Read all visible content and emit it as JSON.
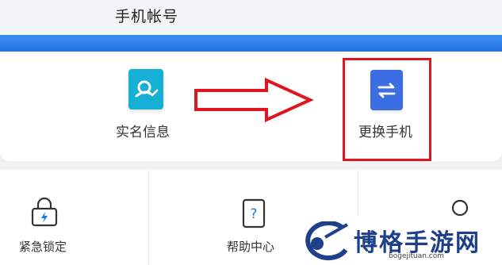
{
  "header": {
    "title": "手机帐号"
  },
  "colors": {
    "accent_blue": "#1f73e6",
    "highlight_red": "#e0141e",
    "teal_tile": "#16b0d6",
    "blue_tile": "#3c6de3"
  },
  "services": [
    {
      "label": "实名信息",
      "icon": "id-verify-icon"
    },
    {
      "label": "更换手机",
      "icon": "swap-arrows-icon"
    }
  ],
  "grid": [
    {
      "label": "紧急锁定",
      "icon": "lock-lightning-icon"
    },
    {
      "label": "帮助中心",
      "icon": "help-question-icon"
    },
    {
      "label": "",
      "icon": "person-icon"
    }
  ],
  "watermark": {
    "name": "博格手游网",
    "domain": "bogejituan.com"
  }
}
